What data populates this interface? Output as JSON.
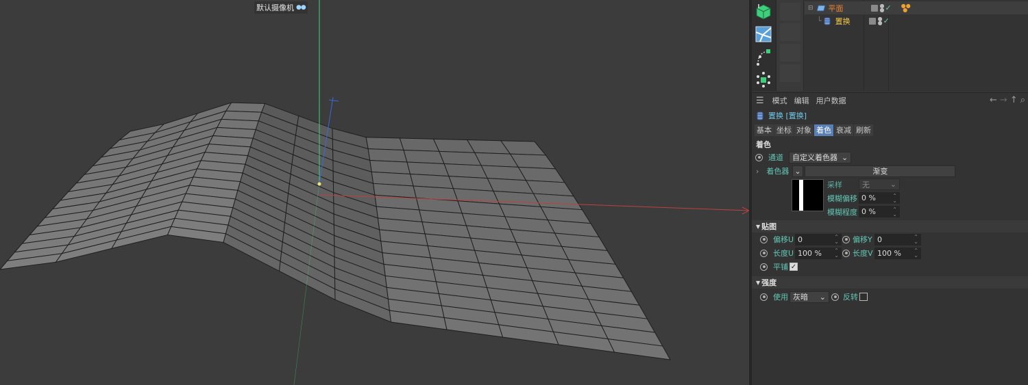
{
  "viewport": {
    "camera_label": "默认摄像机",
    "camera_icon": "camera-icon"
  },
  "object_manager": {
    "objects": [
      {
        "name": "平面",
        "icon": "plane-icon",
        "color": "#f0822d"
      },
      {
        "name": "置换",
        "icon": "displacer-icon",
        "color": "#f2c84b"
      }
    ]
  },
  "attribute_manager": {
    "menu": [
      "模式",
      "编辑",
      "用户数据"
    ],
    "object_title": "置换 [置换]",
    "tabs": [
      "基本",
      "坐标",
      "对象",
      "着色",
      "衰减",
      "刷新"
    ],
    "active_tab": "着色",
    "section": "着色",
    "channel": {
      "label": "通道",
      "value": "自定义着色器"
    },
    "shader": {
      "label": "着色器",
      "value": "渐变"
    },
    "sampling": {
      "label": "采样",
      "value": "无"
    },
    "blur_offset": {
      "label": "模糊偏移",
      "value": "0 %"
    },
    "blur_scale": {
      "label": "模糊程度",
      "value": "0 %"
    },
    "mapping": {
      "title": "贴图",
      "offset_u": {
        "label": "偏移U",
        "value": "0"
      },
      "offset_v": {
        "label": "偏移Y",
        "value": "0"
      },
      "length_u": {
        "label": "长度U",
        "value": "100 %"
      },
      "length_v": {
        "label": "长度V",
        "value": "100 %"
      },
      "tile": {
        "label": "平铺",
        "checked": true
      }
    },
    "strength": {
      "title": "强度",
      "use": {
        "label": "使用",
        "value": "灰暗"
      },
      "invert": {
        "label": "反转",
        "checked": false
      }
    }
  },
  "colors": {
    "accent": "#61c5b4",
    "title_blue": "#6fc8e8",
    "active_tab": "#5a7fb5"
  }
}
